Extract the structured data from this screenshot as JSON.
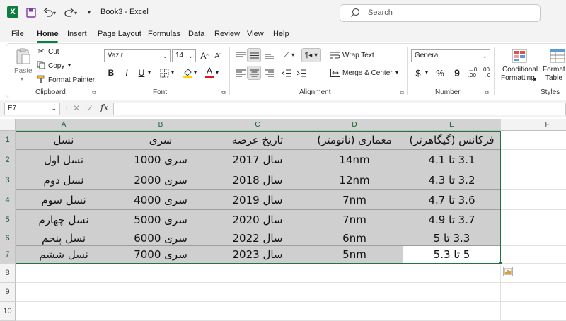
{
  "app": {
    "title": "Book3  -  Excel",
    "search_placeholder": "Search"
  },
  "menu": {
    "tabs": [
      "File",
      "Home",
      "Insert",
      "Page Layout",
      "Formulas",
      "Data",
      "Review",
      "View",
      "Help"
    ],
    "active": "Home"
  },
  "ribbon": {
    "clipboard": {
      "paste": "Paste",
      "cut": "Cut",
      "copy": "Copy",
      "format_painter": "Format Painter",
      "label": "Clipboard"
    },
    "font": {
      "name": "Vazir",
      "size": "14",
      "bold": "B",
      "italic": "I",
      "underline": "U",
      "grow": "A",
      "shrink": "A",
      "font_color": "A",
      "label": "Font"
    },
    "alignment": {
      "wrap_text": "Wrap Text",
      "merge_center": "Merge & Center",
      "label": "Alignment"
    },
    "number": {
      "format": "General",
      "currency": "$",
      "percent": "%",
      "comma": "9",
      "label": "Number"
    },
    "styles": {
      "conditional_formatting_line1": "Conditional",
      "conditional_formatting_line2": "Formatting",
      "format_as_table_line1": "Format a",
      "format_as_table_line2": "Table",
      "label": "Styles"
    }
  },
  "formula_bar": {
    "name_box": "E7",
    "fx": "fx",
    "value": ""
  },
  "sheet": {
    "columns": [
      "A",
      "B",
      "C",
      "D",
      "E",
      "F"
    ],
    "rows": [
      "1",
      "2",
      "3",
      "4",
      "5",
      "6",
      "7",
      "8",
      "9",
      "10"
    ],
    "cells": [
      [
        "نسل",
        "سری",
        "تاریخ عرضه",
        "معماری (نانومتر)",
        "فرکانس (گیگاهرتز)"
      ],
      [
        "نسل اول",
        "سری 1000",
        "سال 2017",
        "14nm",
        "3.1 تا 4.1"
      ],
      [
        "نسل دوم",
        "سری 2000",
        "سال 2018",
        "12nm",
        "3.2 تا 4.3"
      ],
      [
        "نسل سوم",
        "سری 4000",
        "سال 2019",
        "7nm",
        "3.6 تا 4.7"
      ],
      [
        "نسل چهارم",
        "سری 5000",
        "سال 2020",
        "7nm",
        "3.7 تا 4.9"
      ],
      [
        "نسل پنجم",
        "سری 6000",
        "سال 2022",
        "6nm",
        "3.3 تا 5"
      ],
      [
        "نسل ششم",
        "سری 7000",
        "سال 2023",
        "5nm",
        "5 تا 5.3"
      ]
    ],
    "active_cell": "E7"
  },
  "colors": {
    "accent": "#107c41",
    "selection_fill": "#cfcfcf",
    "selection_border": "#217346"
  }
}
